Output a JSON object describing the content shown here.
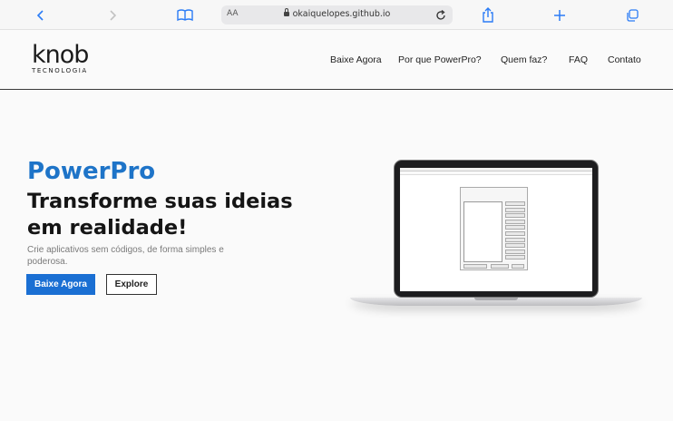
{
  "browser": {
    "aa_label": "AA",
    "url": "okaiquelopes.github.io",
    "icons": [
      "chevron-left-icon",
      "chevron-right-icon",
      "book-icon",
      "lock-icon",
      "reload-icon",
      "share-icon",
      "plus-icon",
      "tabs-icon"
    ]
  },
  "header": {
    "logo_word": "knob",
    "logo_sub": "TECNOLOGIA",
    "nav": [
      "Baixe Agora",
      "Por que PowerPro?",
      "Quem faz?",
      "FAQ",
      "Contato"
    ]
  },
  "hero": {
    "title": "PowerPro",
    "heading": "Transforme suas ideias em realidade!",
    "subtitle": "Crie aplicativos sem códigos, de forma simples e poderosa.",
    "primary_button": "Baixe Agora",
    "secondary_button": "Explore"
  },
  "colors": {
    "accent": "#1e74c8",
    "button_blue": "#1a6fd3",
    "background": "#fafafa",
    "browser_icon": "#2b7cf6"
  }
}
